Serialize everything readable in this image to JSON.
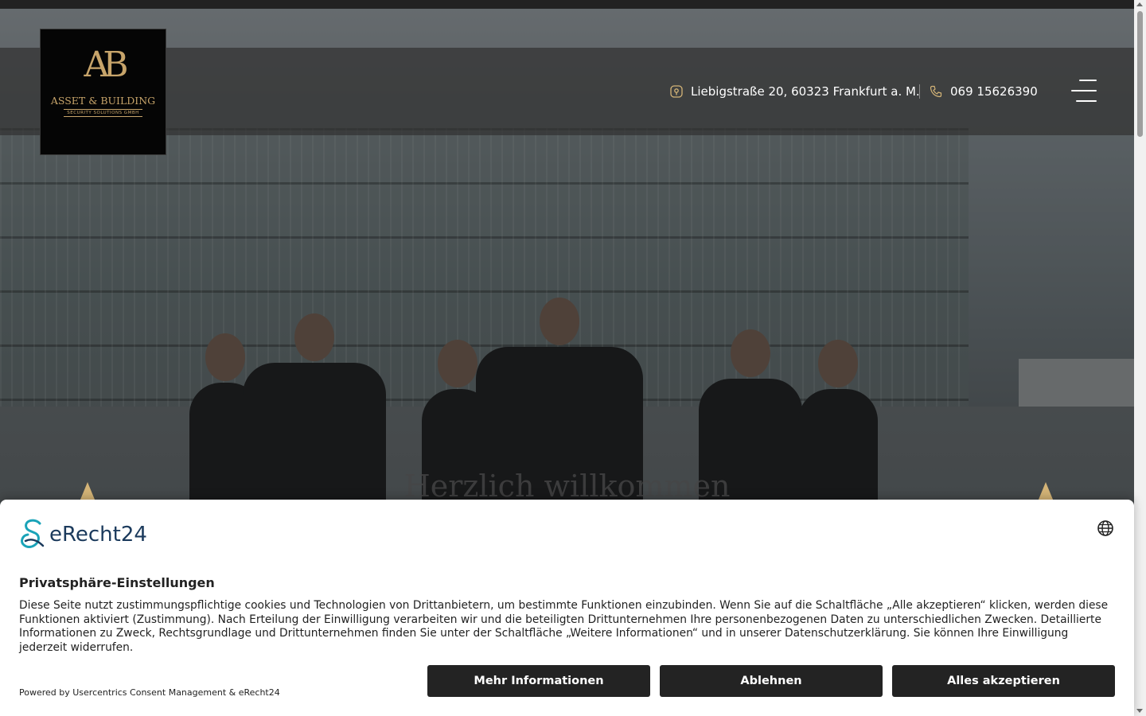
{
  "header": {
    "company_name": "ASSET & BUILDING",
    "company_sub": "SECURITY SOLUTIONS GMBH",
    "address": "Liebigstraße 20, 60323 Frankfurt a. M.",
    "phone": "069 15626390"
  },
  "hero": {
    "welcome_text": "Herzlich willkommen"
  },
  "consent": {
    "brand": "eRecht24",
    "title": "Privatsphäre-Einstellungen",
    "text": "Diese Seite nutzt zustimmungspflichtige cookies und Technologien von Drittanbietern, um bestimmte Funktionen einzubinden. Wenn Sie auf die Schaltfläche „Alle akzeptieren“ klicken, werden diese Funktionen aktiviert (Zustimmung). Nach Erteilung der Einwilligung verarbeiten wir und die beteiligten Drittunternehmen Ihre personenbezogenen Daten zu unterschiedlichen Zwecken. Detaillierte Informationen zu Zweck, Rechtsgrundlage und Drittunternehmen finden Sie unter der Schaltfläche „Weitere Informationen“ und in unserer Datenschutzerklärung. Sie können Ihre Einwilligung jederzeit widerrufen.",
    "powered_by": "Powered by Usercentrics Consent Management & eRecht24",
    "buttons": {
      "more_info": "Mehr Informationen",
      "decline": "Ablehnen",
      "accept_all": "Alles akzeptieren"
    }
  },
  "icons": {
    "address": "map-marker-icon",
    "phone": "phone-icon",
    "menu": "hamburger-menu-icon",
    "language": "globe-icon"
  },
  "colors": {
    "gold_accent": "#c7a46a",
    "button_dark": "#232323",
    "erecht_blue": "#1b3a5c",
    "erecht_teal": "#1aa3b8"
  }
}
